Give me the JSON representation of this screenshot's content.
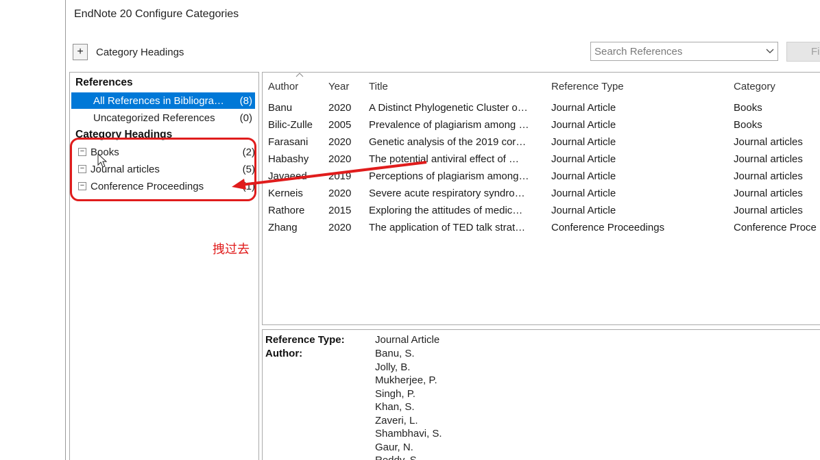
{
  "window": {
    "title": "EndNote 20 Configure Categories"
  },
  "toolbar": {
    "add_label": "+",
    "category_headings_label": "Category Headings",
    "search_placeholder": "Search References",
    "find_label": "Fi"
  },
  "left_panel": {
    "references_header": "References",
    "all_refs": {
      "label": "All References in Bibliogra…",
      "count": "(8)"
    },
    "uncategorized": {
      "label": "Uncategorized References",
      "count": "(0)"
    },
    "category_headings_header": "Category Headings",
    "categories": [
      {
        "label": "Books",
        "count": "(2)"
      },
      {
        "label": "Journal articles",
        "count": "(5)"
      },
      {
        "label": "Conference Proceedings",
        "count": "(1)"
      }
    ]
  },
  "annotation": {
    "text": "拽过去",
    "color": "#e01c1c"
  },
  "ref_table": {
    "columns": [
      "Author",
      "Year",
      "Title",
      "Reference Type",
      "Category"
    ],
    "rows": [
      [
        "Banu",
        "2020",
        "A Distinct Phylogenetic Cluster o…",
        "Journal Article",
        "Books"
      ],
      [
        "Bilic-Zulle",
        "2005",
        "Prevalence of plagiarism among …",
        "Journal Article",
        "Books"
      ],
      [
        "Farasani",
        "2020",
        "Genetic analysis of the 2019 cor…",
        "Journal Article",
        "Journal articles"
      ],
      [
        "Habashy",
        "2020",
        "The potential antiviral effect of …",
        "Journal Article",
        "Journal articles"
      ],
      [
        "Javaeed",
        "2019",
        "Perceptions of plagiarism among…",
        "Journal Article",
        "Journal articles"
      ],
      [
        "Kerneis",
        "2020",
        "Severe acute respiratory syndro…",
        "Journal Article",
        "Journal articles"
      ],
      [
        "Rathore",
        "2015",
        "Exploring the attitudes of medic…",
        "Journal Article",
        "Journal articles"
      ],
      [
        "Zhang",
        "2020",
        "The application of TED talk strat…",
        "Conference Proceedings",
        "Conference Proce"
      ]
    ]
  },
  "preview": {
    "ref_type_label": "Reference Type:",
    "ref_type_value": "Journal Article",
    "author_label": "Author:",
    "authors": [
      "Banu, S.",
      "Jolly, B.",
      "Mukherjee, P.",
      "Singh, P.",
      "Khan, S.",
      "Zaveri, L.",
      "Shambhavi, S.",
      "Gaur, N.",
      "Reddy, S."
    ]
  },
  "colors": {
    "selection": "#0078d7",
    "annotation": "#e01c1c"
  }
}
